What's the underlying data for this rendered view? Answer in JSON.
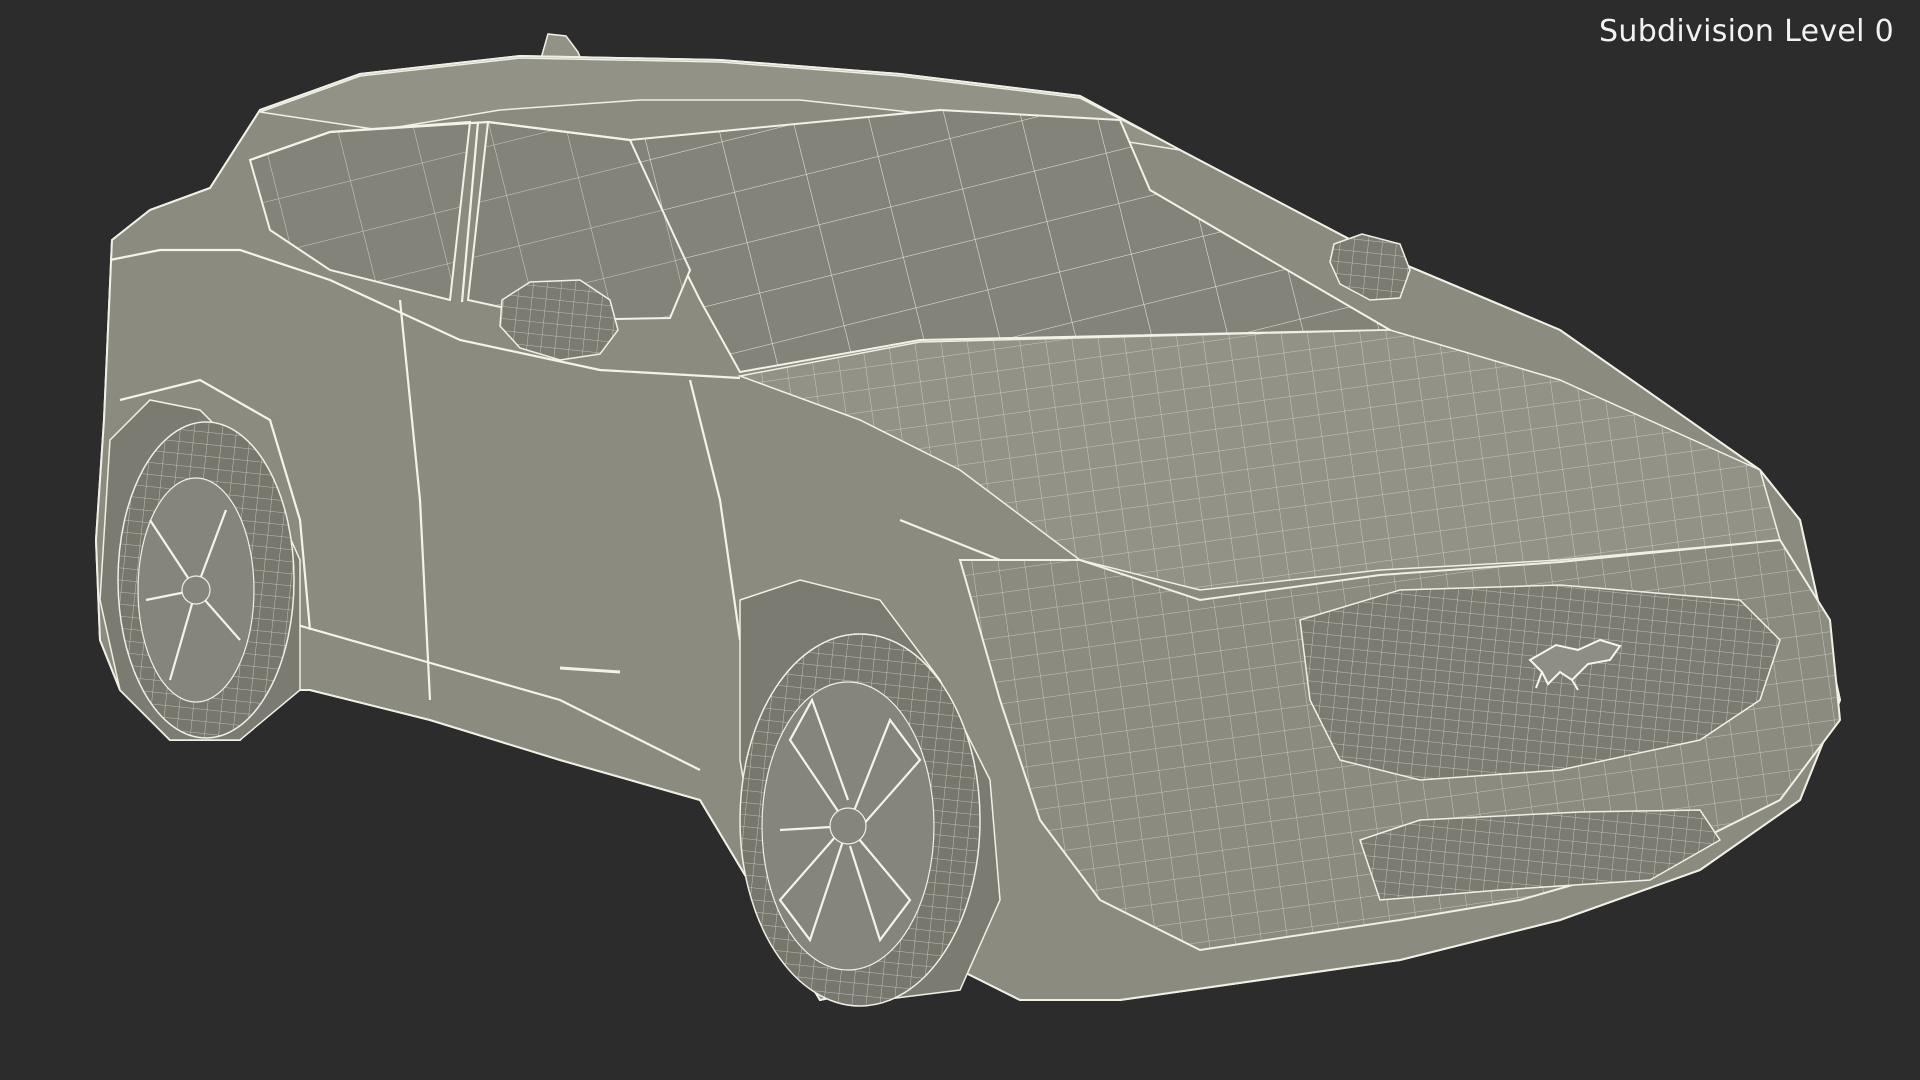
{
  "overlay": {
    "subdivision_label": "Subdivision Level 0"
  },
  "scene": {
    "subject": "car-wireframe-render",
    "background_color": "#2c2c2c",
    "mesh_fill_color": "#8b8b80",
    "wire_color": "#efeee4"
  }
}
